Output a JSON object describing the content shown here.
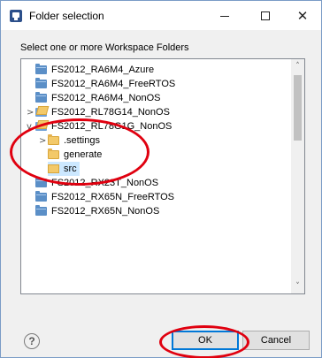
{
  "window": {
    "title": "Folder selection",
    "app_icon": "eclipse-window-icon",
    "minimize_icon": "minimize-icon",
    "maximize_icon": "maximize-icon",
    "close_glyph": "✕"
  },
  "instruction": "Select one or more Workspace Folders",
  "tree": {
    "items": [
      {
        "label": "FS2012_RA6M4_Azure",
        "level": 0,
        "state": "closed",
        "toggle": ""
      },
      {
        "label": "FS2012_RA6M4_FreeRTOS",
        "level": 0,
        "state": "closed",
        "toggle": ""
      },
      {
        "label": "FS2012_RA6M4_NonOS",
        "level": 0,
        "state": "closed",
        "toggle": ""
      },
      {
        "label": "FS2012_RL78G14_NonOS",
        "level": 0,
        "state": "project",
        "toggle": ">"
      },
      {
        "label": "FS2012_RL78G1G_NonOS",
        "level": 0,
        "state": "project-open",
        "toggle": "v"
      },
      {
        "label": ".settings",
        "level": 1,
        "state": "open",
        "toggle": ">"
      },
      {
        "label": "generate",
        "level": 1,
        "state": "open",
        "toggle": ""
      },
      {
        "label": "src",
        "level": 1,
        "state": "open-selected",
        "toggle": ""
      },
      {
        "label": "FS2012_RX23T_NonOS",
        "level": 0,
        "state": "closed",
        "toggle": ""
      },
      {
        "label": "FS2012_RX65N_FreeRTOS",
        "level": 0,
        "state": "closed",
        "toggle": ""
      },
      {
        "label": "FS2012_RX65N_NonOS",
        "level": 0,
        "state": "closed",
        "toggle": ""
      }
    ],
    "selected": "src",
    "scroll_up": "˄",
    "scroll_down": "˅"
  },
  "footer": {
    "help_label": "?",
    "ok_label": "OK",
    "cancel_label": "Cancel"
  },
  "annotation_color": "#e0000f"
}
